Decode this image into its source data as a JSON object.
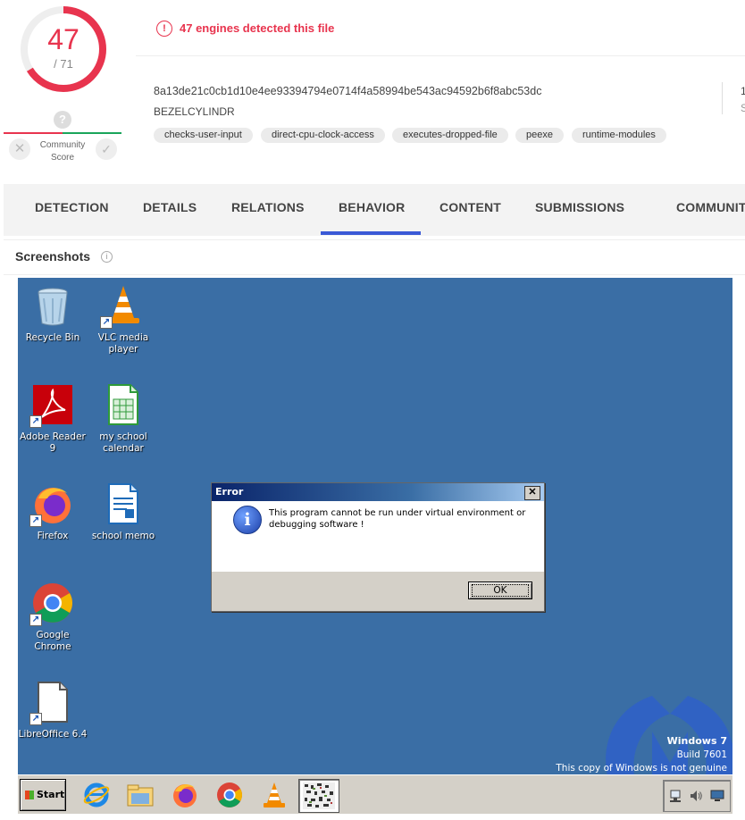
{
  "score": {
    "detected": "47",
    "total": "/ 71"
  },
  "community": {
    "label_line1": "Community",
    "label_line2": "Score",
    "question": "?"
  },
  "detection_banner": "47 engines detected this file",
  "file": {
    "hash": "8a13de21c0cb1d10e4ee93394794e0714f4a58994be543ac94592b6f8abc53dc",
    "name": "BEZELCYLINDR",
    "size_stub": "1",
    "size_stub2": "S"
  },
  "tags": [
    "checks-user-input",
    "direct-cpu-clock-access",
    "executes-dropped-file",
    "peexe",
    "runtime-modules"
  ],
  "tabs": [
    "DETECTION",
    "DETAILS",
    "RELATIONS",
    "BEHAVIOR",
    "CONTENT",
    "SUBMISSIONS",
    "COMMUNIT"
  ],
  "active_tab": "BEHAVIOR",
  "screenshots_title": "Screenshots",
  "desktop": {
    "icons": [
      {
        "line1": "Recycle Bin",
        "line2": "",
        "icon": "recycle-bin-icon"
      },
      {
        "line1": "VLC media",
        "line2": "player",
        "icon": "vlc-icon"
      },
      {
        "line1": "Adobe Reader",
        "line2": "9",
        "icon": "adobe-reader-icon"
      },
      {
        "line1": "my school",
        "line2": "calendar",
        "icon": "spreadsheet-icon"
      },
      {
        "line1": "Firefox",
        "line2": "",
        "icon": "firefox-icon"
      },
      {
        "line1": "school memo",
        "line2": "",
        "icon": "document-icon"
      },
      {
        "line1": "Google Chrome",
        "line2": "",
        "icon": "chrome-icon"
      },
      {
        "line1": "LibreOffice 6.4",
        "line2": "",
        "icon": "libreoffice-icon"
      }
    ],
    "windows_name": "Windows 7",
    "windows_build": "Build 7601",
    "windows_genuine": "This copy of Windows is not genuine"
  },
  "dialog": {
    "title": "Error",
    "close": "✕",
    "message": "This program cannot be run under virtual environment or debugging software !",
    "ok": "OK",
    "icon": "info-icon"
  },
  "taskbar": {
    "start": "Start",
    "icons": [
      "internet-explorer-icon",
      "file-explorer-icon",
      "firefox-icon",
      "chrome-icon",
      "vlc-icon",
      "program-icon"
    ]
  },
  "colors": {
    "accent_red": "#e8344e",
    "tab_active": "#3b5ad6",
    "desktop_bg": "#3a6ea5"
  }
}
